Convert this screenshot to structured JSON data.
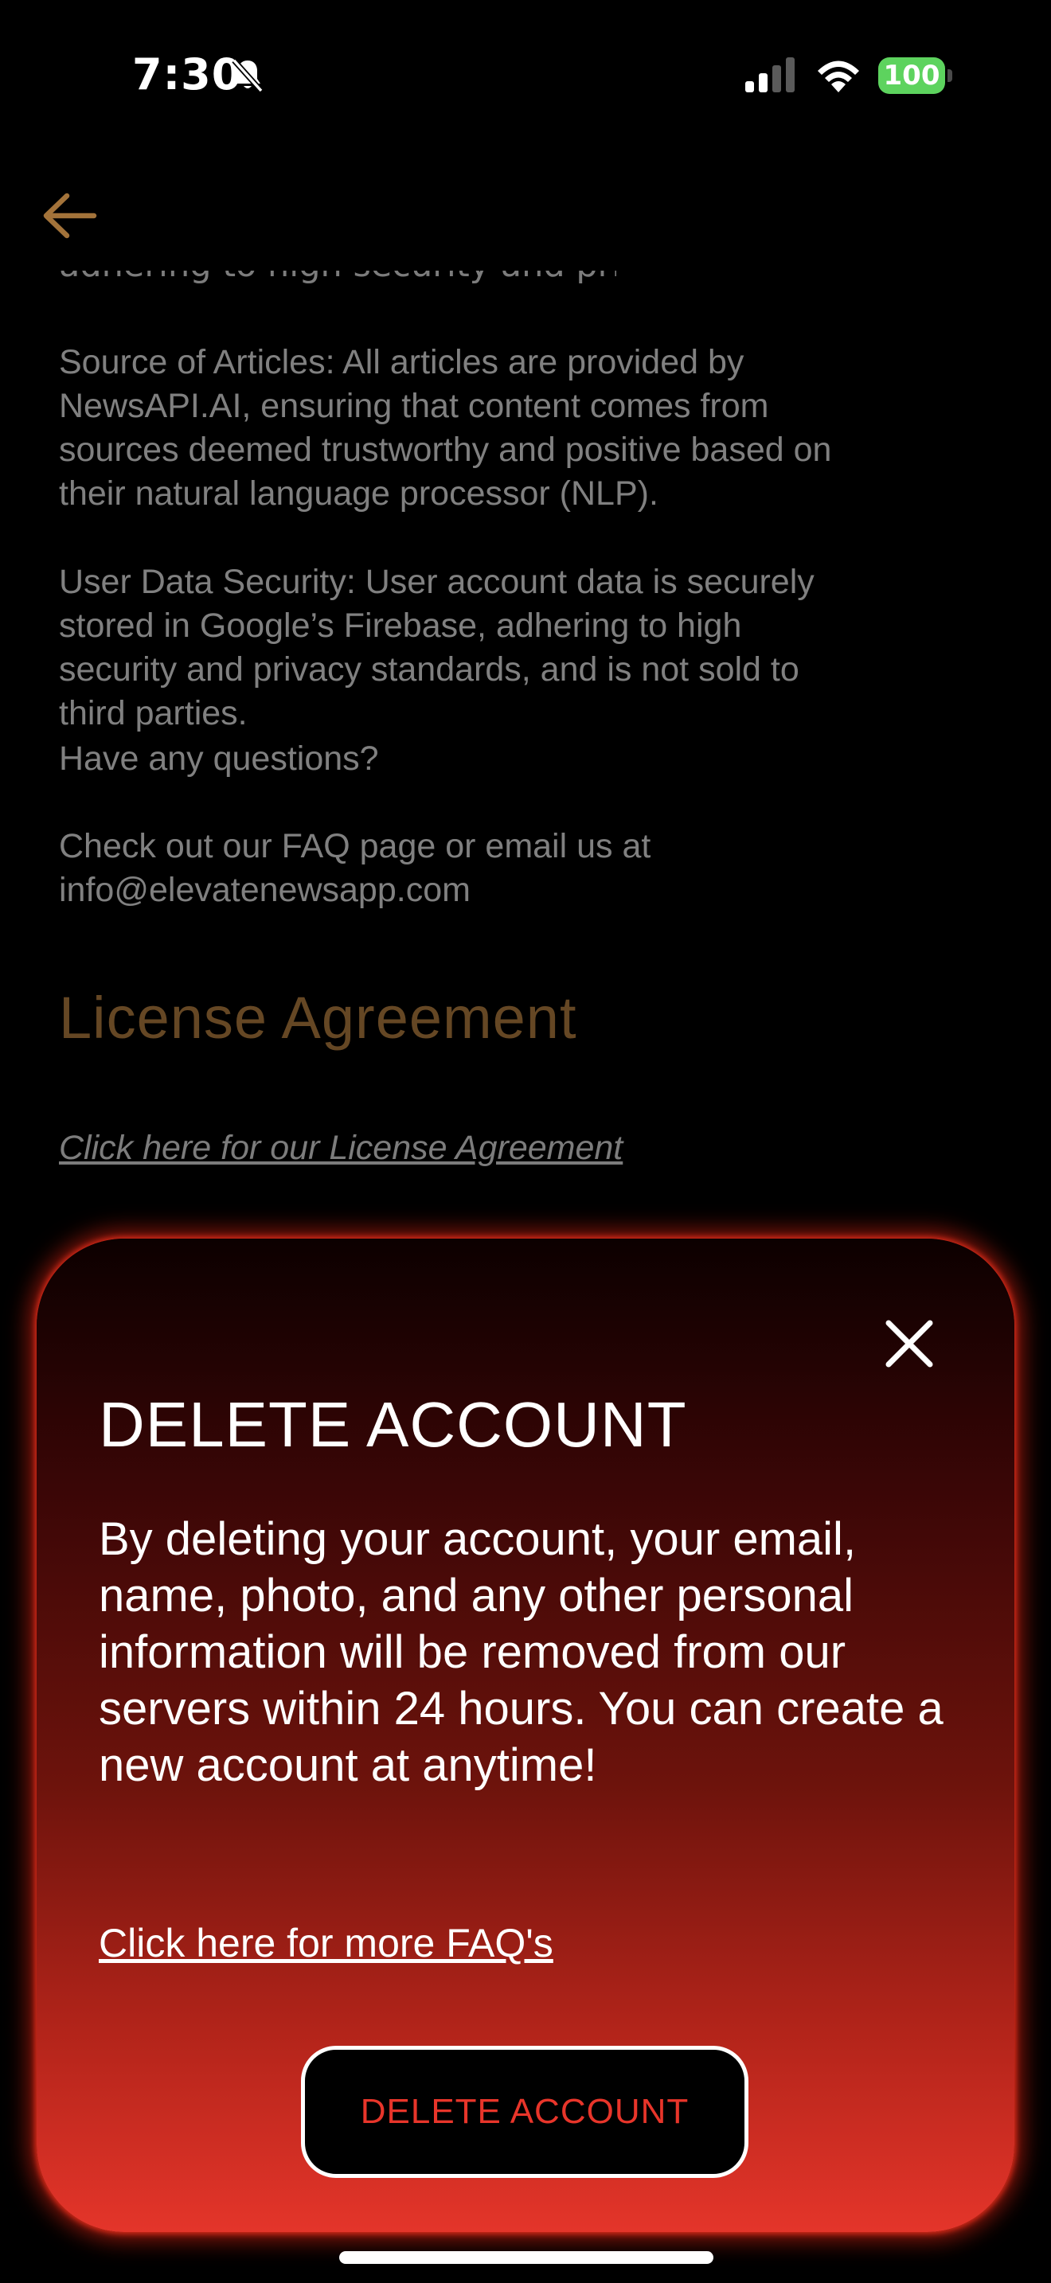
{
  "status_bar": {
    "time": "7:30",
    "battery": "100",
    "icons": [
      "bell-slash-icon",
      "cellular-signal-icon",
      "wifi-icon",
      "battery-icon"
    ],
    "battery_color": "#5dd35e"
  },
  "nav": {
    "back_icon": "arrow-left-icon",
    "accent_color": "#a3733a"
  },
  "content": {
    "clipped_line": "adhering to high security and privacy standards,",
    "source_paragraph": "Source of Articles: All articles are provided by\nNewsAPI.AI, ensuring that content comes from\nsources deemed trustworthy and positive based on\ntheir natural language processor (NLP).",
    "security_paragraph": "User Data Security: User account data is securely\nstored in Google’s Firebase, adhering to high\nsecurity and privacy standards, and is not sold to\nthird parties.",
    "questions": "Have any questions?",
    "contact": "Check out our FAQ page or email us at\ninfo@elevatenewsapp.com",
    "license_heading": "License Agreement",
    "license_link": "Click here for our License Agreement"
  },
  "modal": {
    "close_icon": "close-icon",
    "title": "DELETE ACCOUNT",
    "body": "By deleting your account, your email, name, photo, and any other personal information will be removed from our servers within 24 hours. You can create a new account at anytime!",
    "faq_link": "Click here for more FAQ's",
    "delete_button": "DELETE ACCOUNT",
    "button_text_color": "#e8352a",
    "gradient_colors": [
      "#0c0000",
      "#3a0606",
      "#6d130c",
      "#b3241a",
      "#e4352a"
    ]
  }
}
